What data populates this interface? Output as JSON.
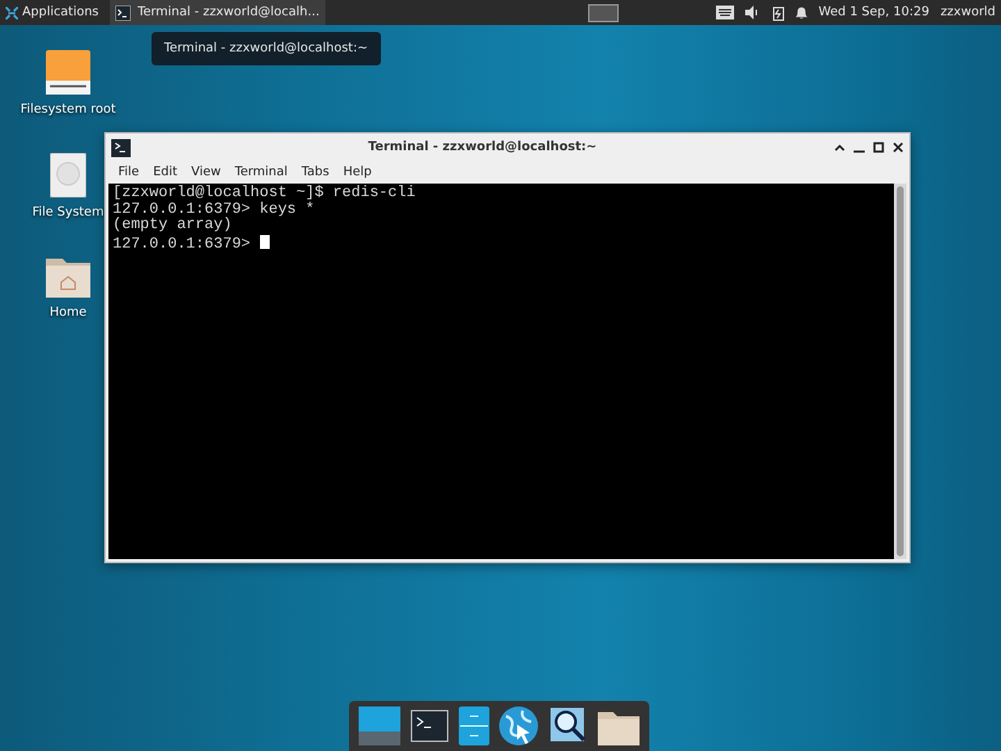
{
  "top_panel": {
    "applications_menu": "Applications",
    "tasks": [
      {
        "title": "Terminal - zzxworld@localh...",
        "selected": true
      }
    ],
    "clock": "Wed 1 Sep, 10:29",
    "user": "zzxworld"
  },
  "tooltip": "Terminal - zzxworld@localhost:~",
  "desktop_icons": [
    {
      "label": "Filesystem root",
      "kind": "drive"
    },
    {
      "label": "File System",
      "kind": "disk"
    },
    {
      "label": "Home",
      "kind": "folder"
    }
  ],
  "terminal_window": {
    "title": "Terminal - zzxworld@localhost:~",
    "menu": [
      "File",
      "Edit",
      "View",
      "Terminal",
      "Tabs",
      "Help"
    ],
    "lines": [
      "[zzxworld@localhost ~]$ redis-cli",
      "127.0.0.1:6379> keys *",
      "(empty array)",
      "127.0.0.1:6379> "
    ]
  },
  "dock": [
    {
      "kind": "desktop"
    },
    {
      "kind": "terminal"
    },
    {
      "kind": "files"
    },
    {
      "kind": "browser"
    },
    {
      "kind": "search"
    },
    {
      "kind": "folder"
    }
  ]
}
